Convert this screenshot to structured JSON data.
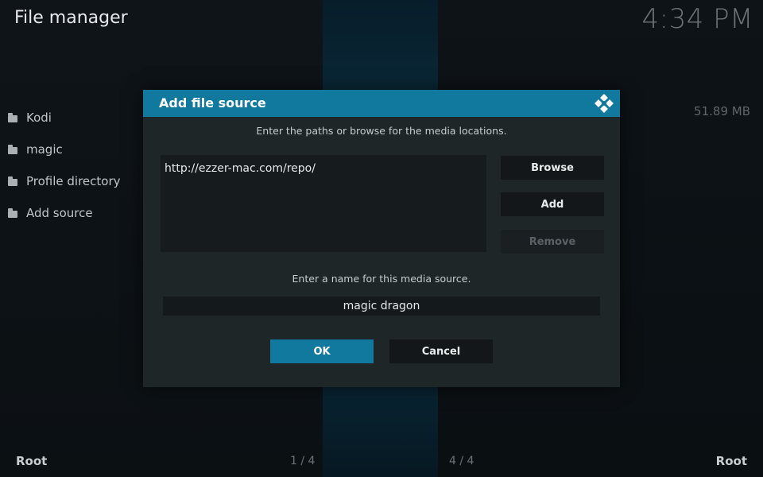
{
  "header": {
    "title": "File manager",
    "clock": "4:34 PM"
  },
  "sources": [
    {
      "label": "Kodi"
    },
    {
      "label": "magic"
    },
    {
      "label": "Profile directory"
    },
    {
      "label": "Add source"
    }
  ],
  "right_panel": {
    "size": "51.89 MB"
  },
  "footer": {
    "left_label": "Root",
    "left_count": "1 / 4",
    "right_count": "4 / 4",
    "right_label": "Root"
  },
  "dialog": {
    "title": "Add file source",
    "instruction_paths": "Enter the paths or browse for the media locations.",
    "path_value": "http://ezzer-mac.com/repo/",
    "browse_label": "Browse",
    "add_label": "Add",
    "remove_label": "Remove",
    "instruction_name": "Enter a name for this media source.",
    "name_value": "magic dragon",
    "ok_label": "OK",
    "cancel_label": "Cancel"
  },
  "colors": {
    "accent": "#12799e",
    "dialog_bg": "#1f2628"
  },
  "icons": {
    "folder": "folder-icon",
    "logo": "kodi-logo-icon"
  }
}
